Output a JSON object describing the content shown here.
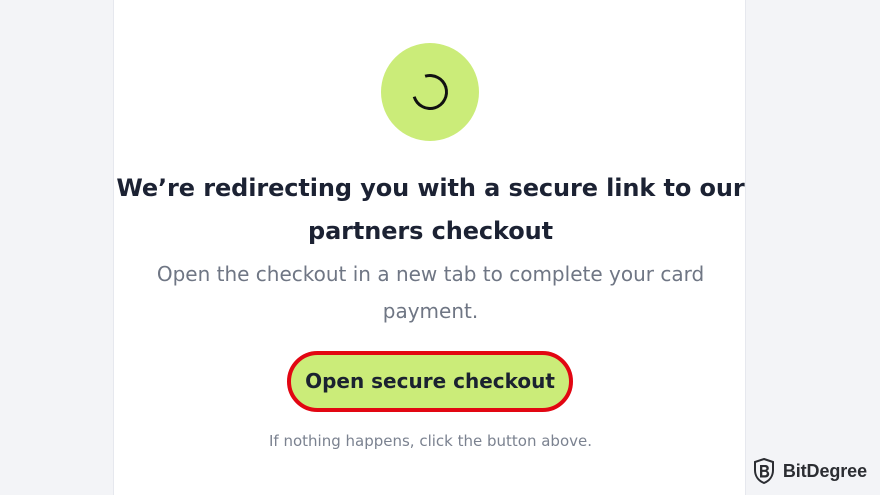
{
  "main": {
    "heading": "We’re redirecting you with a secure link to our partners checkout",
    "body_text": "Open the checkout in a new tab to complete your card payment.",
    "button_label": "Open secure checkout",
    "helper_text": "If nothing happens, click the button above."
  },
  "brand": {
    "name": "BitDegree",
    "icon": "bitdegree-logo-icon"
  },
  "colors": {
    "page_background": "#f3f4f7",
    "card_background": "#ffffff",
    "accent": "#cbec79",
    "button_highlight": "#e20612",
    "heading": "#1c2233",
    "body": "#6f7684"
  },
  "status": {
    "spinner_icon": "loading-spinner-icon"
  }
}
